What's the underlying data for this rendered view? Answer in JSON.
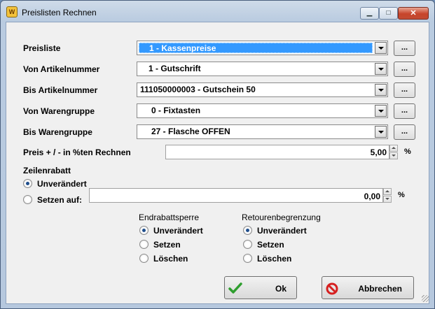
{
  "window": {
    "title": "Preislisten Rechnen",
    "minimize": "▁",
    "maximize": "□",
    "close": "✕",
    "app_icon_text": "W"
  },
  "fields": {
    "preisliste": {
      "label": "Preisliste",
      "value": "1 - Kassenpreise",
      "button": "..."
    },
    "von_artikel": {
      "label": "Von Artikelnummer",
      "value": "1 - Gutschrift",
      "button": "..."
    },
    "bis_artikel": {
      "label": "Bis Artikelnummer",
      "value": "111050000003 - Gutschein  50",
      "button": "..."
    },
    "von_warengruppe": {
      "label": "Von Warengruppe",
      "value": "0 - Fixtasten",
      "button": "..."
    },
    "bis_warengruppe": {
      "label": "Bis Warengruppe",
      "value": "27 - Flasche OFFEN",
      "button": "..."
    }
  },
  "preis": {
    "label": "Preis + / - in %ten Rechnen",
    "value": "5,00",
    "unit": "%"
  },
  "zeilenrabatt": {
    "label": "Zeilenrabatt",
    "option_unchanged": "Unverändert",
    "option_set": "Setzen auf:",
    "selected": "Unverändert",
    "value": "0,00",
    "unit": "%"
  },
  "endrabattsperre": {
    "label": "Endrabattsperre",
    "options": [
      "Unverändert",
      "Setzen",
      "Löschen"
    ],
    "selected": "Unverändert"
  },
  "retourenbegrenzung": {
    "label": "Retourenbegrenzung",
    "options": [
      "Unverändert",
      "Setzen",
      "Löschen"
    ],
    "selected": "Unverändert"
  },
  "buttons": {
    "ok": "Ok",
    "cancel": "Abbrechen"
  },
  "icons": {
    "ok": "check-icon",
    "cancel": "prohibited-icon"
  },
  "colors": {
    "selection": "#3399ff",
    "check": "#2e9e2e",
    "prohibited": "#d62020"
  }
}
